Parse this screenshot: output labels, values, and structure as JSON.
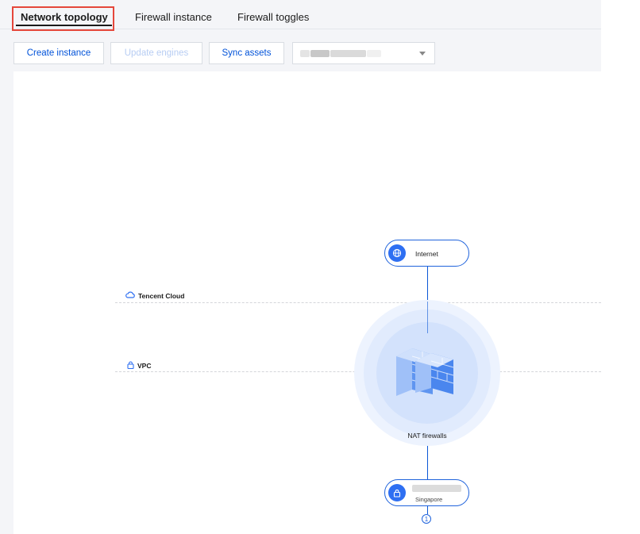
{
  "tabs": [
    {
      "label": "Network topology",
      "active": true
    },
    {
      "label": "Firewall instance",
      "active": false
    },
    {
      "label": "Firewall toggles",
      "active": false
    }
  ],
  "toolbar": {
    "create_label": "Create instance",
    "update_label": "Update engines",
    "update_disabled": true,
    "sync_label": "Sync assets",
    "region_select_value": ""
  },
  "topology": {
    "zones": {
      "cloud_label": "Tencent Cloud",
      "vpc_label": "VPC"
    },
    "internet_label": "Internet",
    "firewall_label": "NAT firewalls",
    "vpc_node": {
      "name": "",
      "region": "Singapore"
    },
    "instance_count": "1"
  },
  "colors": {
    "accent": "#0052d9",
    "node_border": "#1f63dc",
    "highlight": "#e5473b"
  },
  "icons": [
    "globe-icon",
    "cloud-icon",
    "lock-icon",
    "firewall-brick-icon",
    "chevron-down-icon"
  ]
}
